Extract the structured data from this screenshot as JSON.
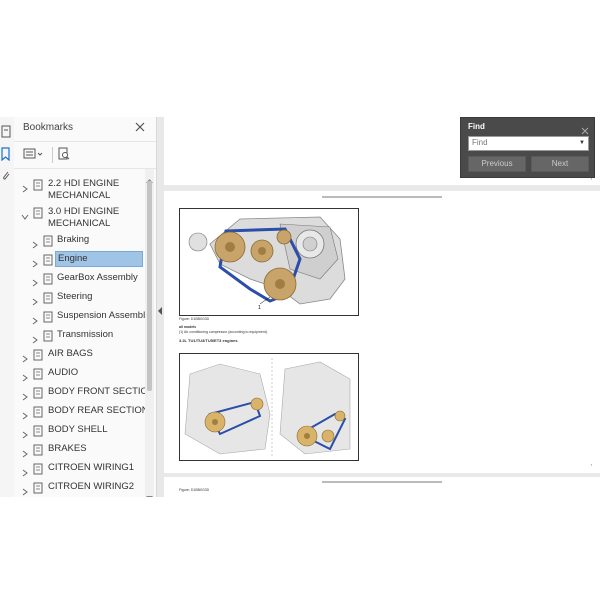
{
  "bookmarks_panel": {
    "title": "Bookmarks",
    "items": [
      {
        "label": "2.2 HDI ENGINE",
        "label2": "MECHANICAL",
        "level": 0,
        "expanded": false
      },
      {
        "label": "3.0 HDI ENGINE",
        "label2": "MECHANICAL",
        "level": 0,
        "expanded": true
      },
      {
        "label": "Braking",
        "level": 1
      },
      {
        "label": "Engine",
        "level": 1,
        "selected": true
      },
      {
        "label": "GearBox Assembly",
        "level": 1
      },
      {
        "label": "Steering",
        "level": 1
      },
      {
        "label": "Suspension Assembly",
        "level": 1
      },
      {
        "label": "Transmission",
        "level": 1
      },
      {
        "label": "AIR BAGS",
        "level": 0
      },
      {
        "label": "AUDIO",
        "level": 0
      },
      {
        "label": "BODY FRONT SECTION",
        "level": 0
      },
      {
        "label": "BODY REAR SECTION",
        "level": 0
      },
      {
        "label": "BODY SHELL",
        "level": 0
      },
      {
        "label": "BRAKES",
        "level": 0
      },
      {
        "label": "CITROEN WIRING1",
        "level": 0
      },
      {
        "label": "CITROEN WIRING2",
        "level": 0
      }
    ]
  },
  "find_box": {
    "title": "Find",
    "placeholder": "Find",
    "previous_label": "Previous",
    "next_label": "Next"
  },
  "document": {
    "caption_1": "Figure: D1BB0G3D",
    "note_1": "all models",
    "note_2": "(1) Air conditioning compressor  (according to equipment).",
    "heading_1": "3.2L TU1/TU3/TU5/ET3 engines",
    "caption_2": "Figure: D1BB0G3D"
  },
  "accent": {
    "selection": "#9fc4e6",
    "find_bg": "#4a4a4a",
    "belt": "#2b4fa8",
    "pulley": "#c9a46a"
  }
}
